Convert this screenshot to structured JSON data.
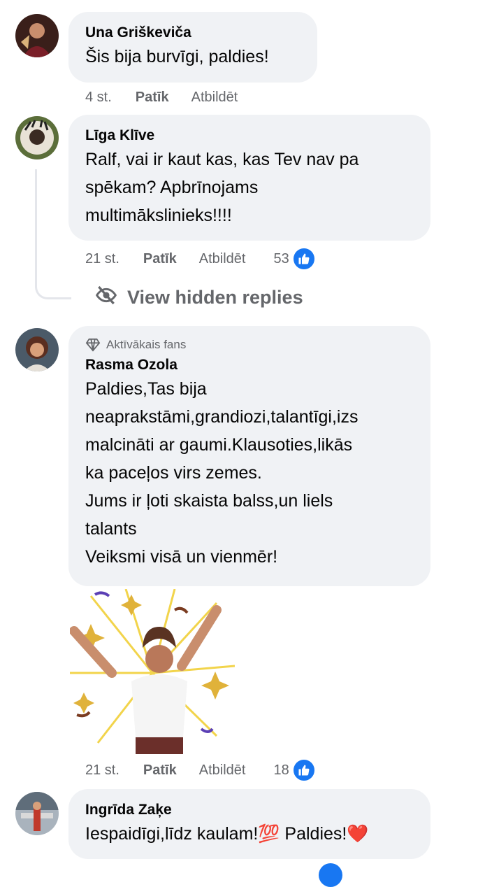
{
  "comments": [
    {
      "author": "Una Griškeviča",
      "text": "Šis bija burvīgi, paldies!",
      "time": "4 st.",
      "like_label": "Patīk",
      "reply_label": "Atbildēt"
    },
    {
      "author": "Līga Klīve",
      "text": "Ralf, vai ir kaut kas, kas Tev nav pa\nspēkam? Apbrīnojams\nmultimākslinieks!!!!",
      "time": "21 st.",
      "like_label": "Patīk",
      "reply_label": "Atbildēt",
      "reaction_count": "53",
      "hidden_replies_label": "View hidden replies"
    },
    {
      "badge": "Aktīvākais fans",
      "author": "Rasma Ozola",
      "text": "Paldies,Tas bija\nneaprakstāmi,grandiozi,talantīgi,izs\nmalcināti ar gaumi.Klausoties,likās\nka paceļos virs zemes.\nJums ir ļoti skaista balss,un liels\ntalants\nVeiksmi visā un vienmēr!",
      "time": "21 st.",
      "like_label": "Patīk",
      "reply_label": "Atbildēt",
      "reaction_count": "18"
    },
    {
      "author": "Ingrīda Zaķe",
      "text": "Iespaidīgi,līdz kaulam!💯 Paldies!❤️"
    }
  ],
  "colors": {
    "bubble_bg": "#f0f2f5",
    "meta_text": "#65676b",
    "like_blue": "#1877f2"
  },
  "icons": [
    "like-thumb-icon",
    "eye-slash-icon",
    "diamond-icon"
  ]
}
